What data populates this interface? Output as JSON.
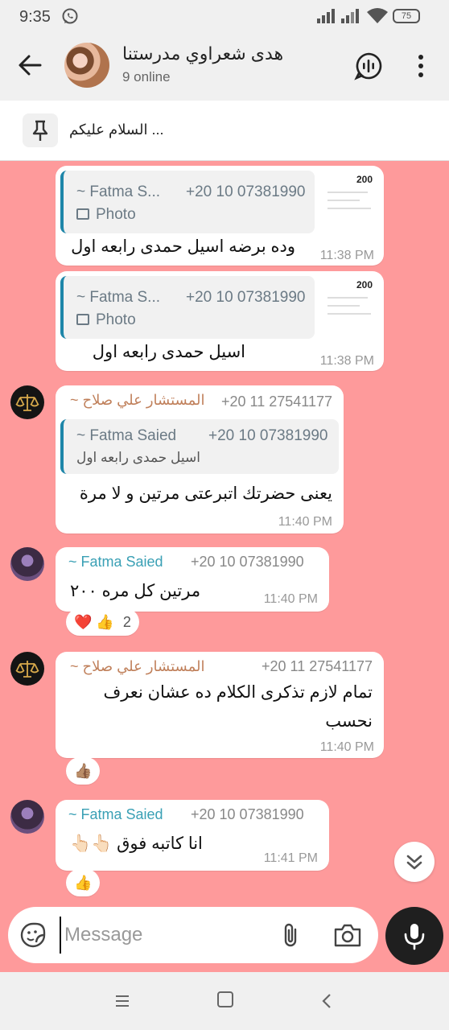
{
  "status": {
    "time": "9:35",
    "battery": "75"
  },
  "header": {
    "title": "هدى شعراوي مدرستنا",
    "subtitle": "9 online"
  },
  "pinned": {
    "text": "السلام عليكم ..."
  },
  "messages": [
    {
      "quote_name": "~ Fatma S...",
      "quote_number": "+20 10 07381990",
      "quote_media": "Photo",
      "quote_price": "200",
      "text": "وده برضه اسيل حمدى رابعه اول",
      "time": "11:38 PM"
    },
    {
      "quote_name": "~ Fatma S...",
      "quote_number": "+20 10 07381990",
      "quote_media": "Photo",
      "quote_price": "200",
      "text": "اسيل حمدى رابعه اول",
      "time": "11:38 PM"
    },
    {
      "sender": "~ المستشار علي صلاح",
      "sender_number": "+20 11 27541177",
      "sender_color": "#c0805b",
      "quote_name": "~ Fatma Saied",
      "quote_number": "+20 10 07381990",
      "quote_text": "اسيل حمدى رابعه اول",
      "text": "يعنى حضرتك اتبرعتى مرتين و لا مرة",
      "time": "11:40 PM"
    },
    {
      "sender": "~ Fatma Saied",
      "sender_number": "+20 10 07381990",
      "sender_color": "#3aa0b5",
      "text": "مرتين كل مره ٢٠٠",
      "time": "11:40 PM",
      "reactions": "❤️ 👍",
      "reaction_count": "2"
    },
    {
      "sender": "~ المستشار علي صلاح",
      "sender_number": "+20 11 27541177",
      "sender_color": "#c0805b",
      "text_line1": "تمام لازم تذكرى الكلام ده عشان نعرف",
      "text_line2": "نحسب",
      "time": "11:40 PM",
      "reactions": "👍🏽"
    },
    {
      "sender": "~ Fatma Saied",
      "sender_number": "+20 10 07381990",
      "sender_color": "#3aa0b5",
      "text": "انا كاتبه فوق 👆🏻👆🏻",
      "time": "11:41 PM",
      "reactions": "👍"
    }
  ],
  "composer": {
    "placeholder": "Message"
  }
}
